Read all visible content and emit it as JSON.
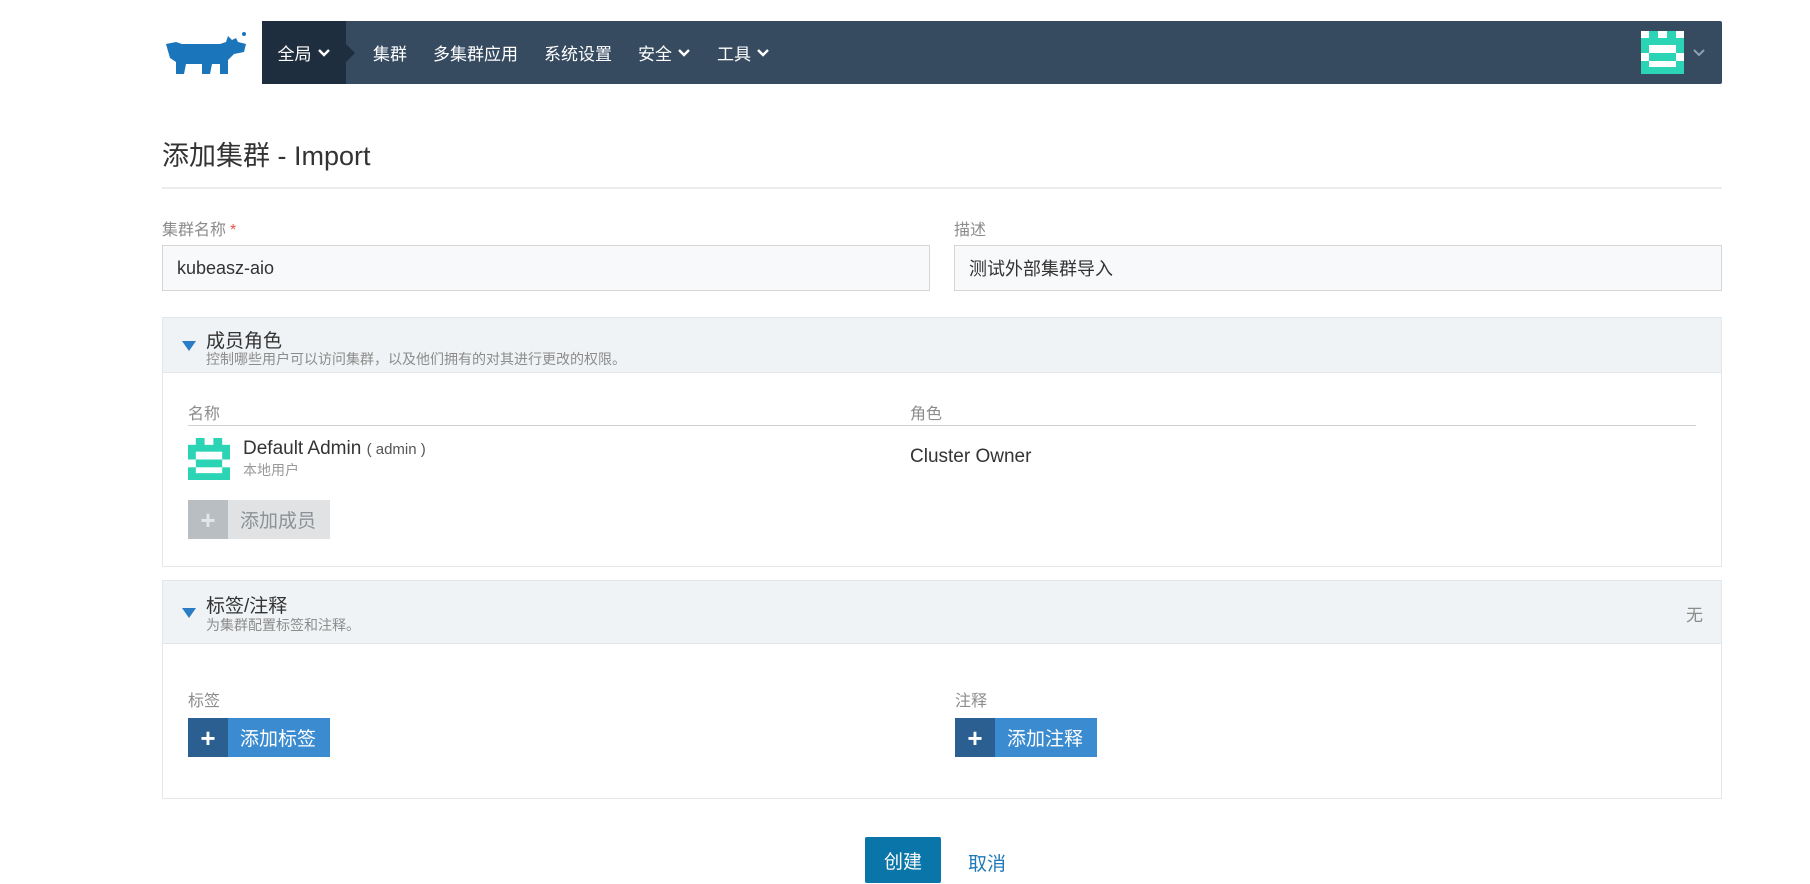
{
  "nav": {
    "global_label": "全局",
    "items": [
      "集群",
      "多集群应用",
      "系统设置",
      "安全",
      "工具"
    ]
  },
  "page": {
    "title": "添加集群 - Import"
  },
  "form": {
    "cluster_name_label": "集群名称",
    "required_mark": "*",
    "cluster_name_value": "kubeasz-aio",
    "description_label": "描述",
    "description_value": "测试外部集群导入"
  },
  "members_panel": {
    "title": "成员角色",
    "subtitle": "控制哪些用户可以访问集群，以及他们拥有的对其进行更改的权限。",
    "col_name": "名称",
    "col_role": "角色",
    "member": {
      "name": "Default Admin",
      "username": "( admin )",
      "type": "本地用户",
      "role": "Cluster Owner"
    },
    "add_member_label": "添加成员"
  },
  "labels_panel": {
    "title": "标签/注释",
    "subtitle": "为集群配置标签和注释。",
    "status": "无",
    "labels_heading": "标签",
    "annotations_heading": "注释",
    "add_label": "添加标签",
    "add_annotation": "添加注释"
  },
  "actions": {
    "create": "创建",
    "cancel": "取消"
  },
  "colors": {
    "nav_bg": "#364a60",
    "nav_active": "#1f2e3e",
    "primary": "#0a75a8",
    "accent_blue": "#3b8bd0",
    "avatar": "#2ad4b4",
    "logo": "#1b75bb"
  },
  "icons": [
    "rancher-logo",
    "chevron-down-icon",
    "avatar-icon",
    "caret-down-icon",
    "plus-icon"
  ]
}
